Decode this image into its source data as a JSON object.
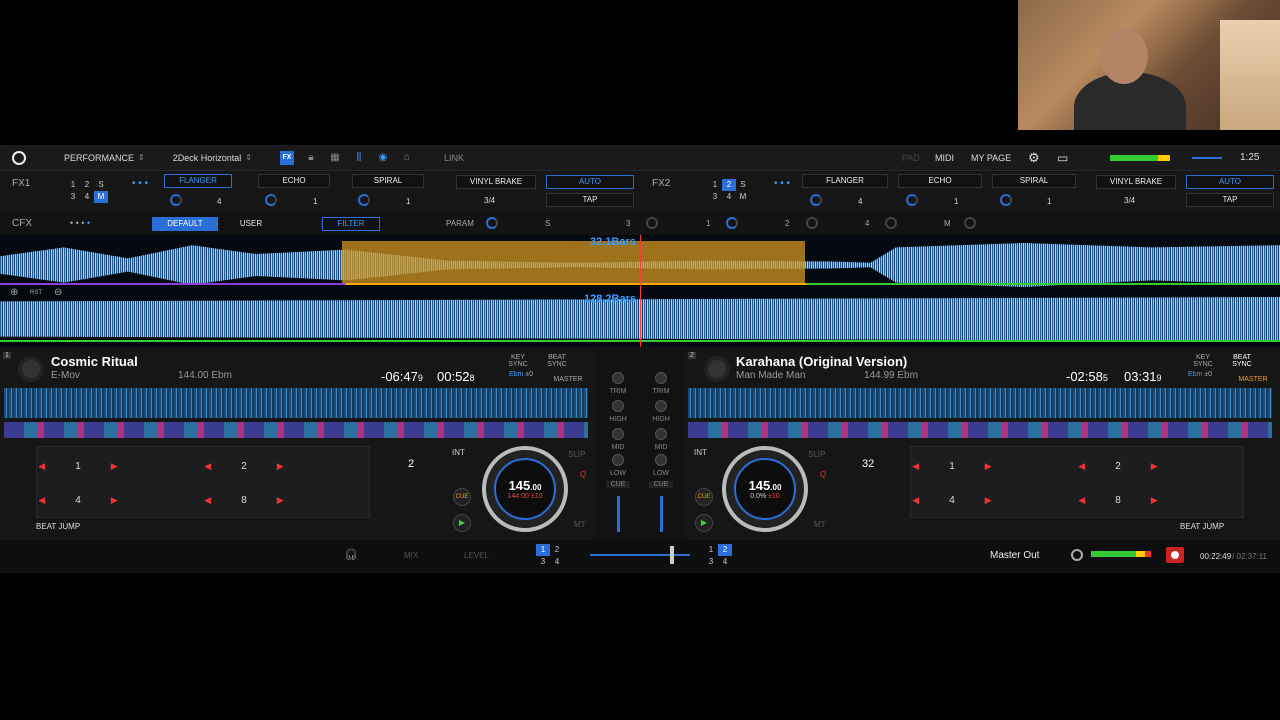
{
  "topbar": {
    "mode": "PERFORMANCE",
    "layout": "2Deck Horizontal",
    "link": "LINK",
    "pad": "PAD",
    "midi": "MIDI",
    "mypage": "MY PAGE",
    "clock": "1:25"
  },
  "fx1": {
    "label": "FX1",
    "slots": [
      "1",
      "2",
      "S",
      "3",
      "4",
      "M"
    ],
    "effects": [
      "FLANGER",
      "ECHO",
      "SPIRAL"
    ],
    "values": [
      "4",
      "1",
      "1"
    ],
    "dot": "•",
    "vinyl": "VINYL BRAKE",
    "vinyl_val": "3/4",
    "auto": "AUTO",
    "tap": "TAP"
  },
  "fx2": {
    "label": "FX2",
    "slots": [
      "1",
      "2",
      "S",
      "3",
      "4",
      "M"
    ],
    "effects": [
      "FLANGER",
      "ECHO",
      "SPIRAL"
    ],
    "values": [
      "4",
      "1",
      "1"
    ],
    "vinyl": "VINYL BRAKE",
    "vinyl_val": "3/4",
    "auto": "AUTO",
    "tap": "TAP"
  },
  "cfx": {
    "label": "CFX",
    "default": "DEFAULT",
    "user": "USER",
    "filter": "FILTER",
    "param": "PARAM",
    "s": "S",
    "n3": "3",
    "n1": "1",
    "n2": "2",
    "n4": "4",
    "m": "M"
  },
  "waveform": {
    "bars_top": "32.1Bars",
    "bars_bottom": "128.2Bars",
    "rst": "RST"
  },
  "deck1": {
    "num": "1",
    "title": "Cosmic Ritual",
    "artist": "E-Mov",
    "bpm_key": "144.00 Ebm",
    "remain": "-06:47",
    "remain_dec": "9",
    "elapsed": "00:52",
    "elapsed_dec": "8",
    "key_sync": "KEY SYNC",
    "key": "Ebm",
    "key_off": "±0",
    "beat_sync": "BEAT SYNC",
    "master": "MASTER",
    "jump": "2",
    "bpm": "145",
    "bpm_dec": ".00",
    "pitch": "144.00",
    "range": "±10",
    "int": "INT",
    "slip": "SLIP",
    "q": "Q",
    "mt": "MT",
    "cue": "CUE",
    "beat_jump": "BEAT JUMP",
    "pads": [
      "1",
      "2",
      "4",
      "8"
    ]
  },
  "deck2": {
    "num": "2",
    "title": "Karahana (Original Version)",
    "artist": "Man Made Man",
    "bpm_key": "144.99 Ebm",
    "remain": "-02:58",
    "remain_dec": "5",
    "elapsed": "03:31",
    "elapsed_dec": "9",
    "key_sync": "KEY SYNC",
    "key": "Ebm",
    "key_off": "±0",
    "beat_sync": "BEAT SYNC",
    "master": "MASTER",
    "jump": "32",
    "bpm": "145",
    "bpm_dec": ".00",
    "pitch": "0.0%",
    "range": "±10",
    "int": "INT",
    "slip": "SLIP",
    "q": "Q",
    "mt": "MT",
    "cue": "CUE",
    "beat_jump": "BEAT JUMP",
    "pads": [
      "1",
      "2",
      "4",
      "8"
    ]
  },
  "mixer": {
    "trim": "TRIM",
    "high": "HIGH",
    "mid": "MID",
    "low": "LOW",
    "cue": "CUE"
  },
  "bottom": {
    "mix": "MIX",
    "level": "LEVEL",
    "master_out": "Master Out",
    "rec_time": "00:22:49",
    "total_time": "/ 02:37:11",
    "a1": "1",
    "a2": "2",
    "a3": "3",
    "a4": "4"
  },
  "colors": {
    "accent": "#2a6fd8",
    "loop": "#d2961e",
    "wave": "#5fd0ff"
  }
}
